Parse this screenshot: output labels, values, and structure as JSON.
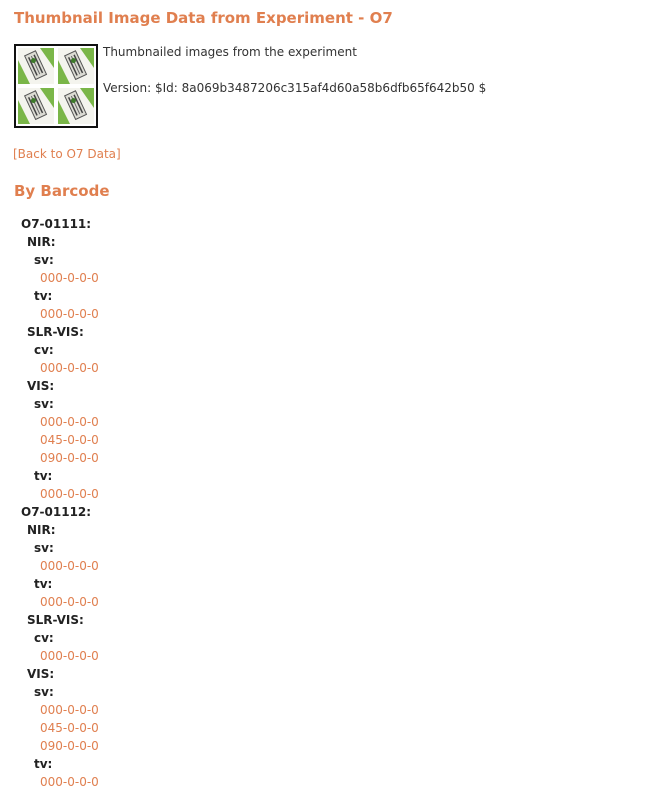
{
  "page": {
    "title": "Thumbnail Image Data from Experiment - O7",
    "description": "Thumbnailed images from the experiment",
    "version": "Version: $Id: 8a069b3487206c315af4d60a58b6dfb65f642b50 $",
    "back_link": "[Back to O7 Data]",
    "section_heading": "By Barcode"
  },
  "colors": {
    "accent": "#e07f4f",
    "text": "#333333",
    "tree_label": "#222222",
    "thumbnail_green": "#7ab648",
    "thumbnail_border": "#111111"
  },
  "thumbnail_icon": "plant-thumbnails-icon",
  "barcodes": [
    {
      "label": "O7-01111:",
      "cameras": [
        {
          "label": "NIR:",
          "views": [
            {
              "label": "sv:",
              "images": [
                "000-0-0-0"
              ]
            },
            {
              "label": "tv:",
              "images": [
                "000-0-0-0"
              ]
            }
          ]
        },
        {
          "label": "SLR-VIS:",
          "views": [
            {
              "label": "cv:",
              "images": [
                "000-0-0-0"
              ]
            }
          ]
        },
        {
          "label": "VIS:",
          "views": [
            {
              "label": "sv:",
              "images": [
                "000-0-0-0",
                "045-0-0-0",
                "090-0-0-0"
              ]
            },
            {
              "label": "tv:",
              "images": [
                "000-0-0-0"
              ]
            }
          ]
        }
      ]
    },
    {
      "label": "O7-01112:",
      "cameras": [
        {
          "label": "NIR:",
          "views": [
            {
              "label": "sv:",
              "images": [
                "000-0-0-0"
              ]
            },
            {
              "label": "tv:",
              "images": [
                "000-0-0-0"
              ]
            }
          ]
        },
        {
          "label": "SLR-VIS:",
          "views": [
            {
              "label": "cv:",
              "images": [
                "000-0-0-0"
              ]
            }
          ]
        },
        {
          "label": "VIS:",
          "views": [
            {
              "label": "sv:",
              "images": [
                "000-0-0-0",
                "045-0-0-0",
                "090-0-0-0"
              ]
            },
            {
              "label": "tv:",
              "images": [
                "000-0-0-0"
              ]
            }
          ]
        }
      ]
    }
  ]
}
